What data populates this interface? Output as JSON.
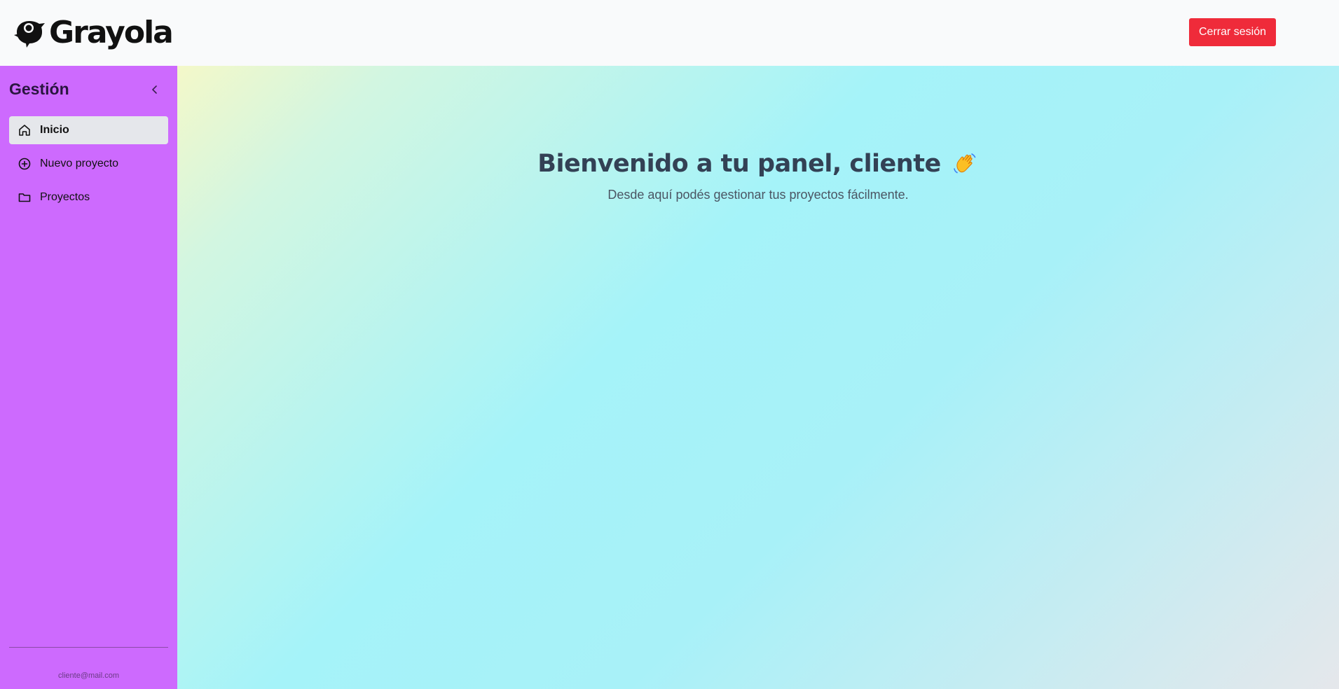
{
  "header": {
    "brand": "Grayola",
    "logout_label": "Cerrar sesión"
  },
  "sidebar": {
    "title": "Gestión",
    "items": [
      {
        "label": "Inicio",
        "icon": "home-icon",
        "active": true
      },
      {
        "label": "Nuevo proyecto",
        "icon": "plus-circle-icon",
        "active": false
      },
      {
        "label": "Proyectos",
        "icon": "folder-icon",
        "active": false
      }
    ],
    "user_email": "cliente@mail.com"
  },
  "main": {
    "title": "Bienvenido a tu panel, cliente",
    "subtitle": "Desde aquí podés gestionar tus proyectos fácilmente.",
    "emoji": "waving-hand"
  },
  "colors": {
    "sidebar_bg": "#cd6afe",
    "logout_bg": "#ef2b3a",
    "active_item_bg": "#e5e7eb"
  }
}
